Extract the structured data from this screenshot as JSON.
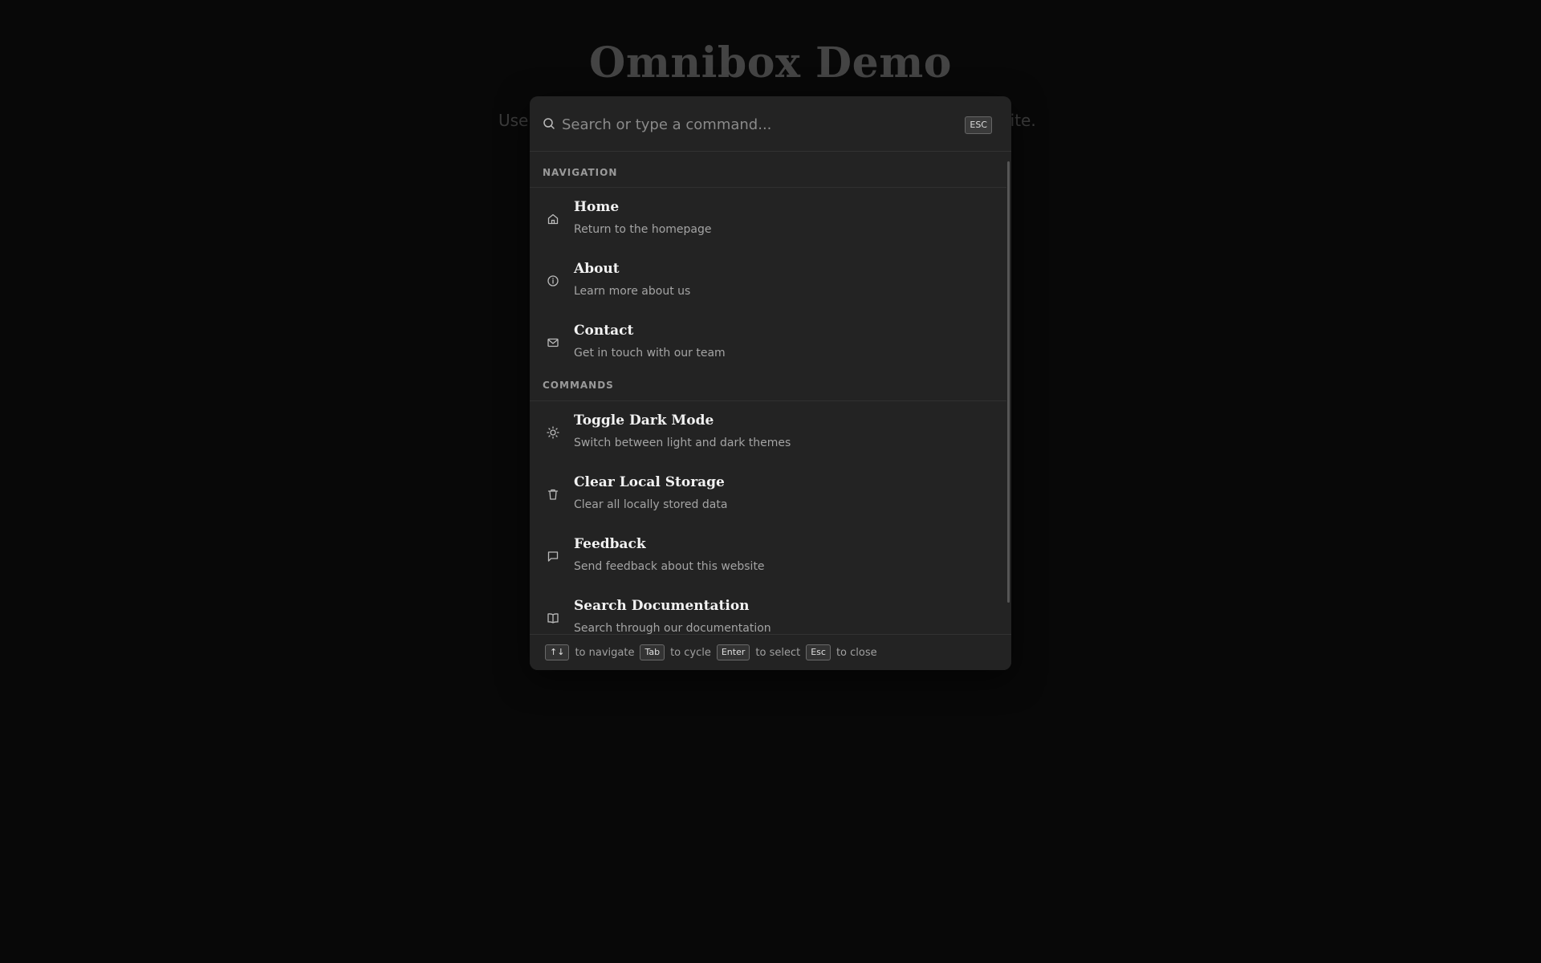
{
  "page": {
    "title": "Omnibox Demo",
    "subtitle_left": "Use",
    "subtitle_right": "osite."
  },
  "search": {
    "placeholder": "Search or type a command...",
    "esc_label": "ESC",
    "icon": "search-icon"
  },
  "sections": {
    "navigation": {
      "label": "NAVIGATION",
      "items": [
        {
          "title": "Home",
          "description": "Return to the homepage",
          "icon": "home-icon"
        },
        {
          "title": "About",
          "description": "Learn more about us",
          "icon": "info-icon"
        },
        {
          "title": "Contact",
          "description": "Get in touch with our team",
          "icon": "mail-icon"
        }
      ]
    },
    "commands": {
      "label": "COMMANDS",
      "items": [
        {
          "title": "Toggle Dark Mode",
          "description": "Switch between light and dark themes",
          "icon": "sun-icon"
        },
        {
          "title": "Clear Local Storage",
          "description": "Clear all locally stored data",
          "icon": "trash-icon"
        },
        {
          "title": "Feedback",
          "description": "Send feedback about this website",
          "icon": "message-icon"
        },
        {
          "title": "Search Documentation",
          "description": "Search through our documentation",
          "icon": "book-icon"
        }
      ]
    }
  },
  "footer": {
    "navigate_key": "↑↓",
    "navigate_text": "to navigate",
    "cycle_key": "Tab",
    "cycle_text": "to cycle",
    "select_key": "Enter",
    "select_text": "to select",
    "close_key": "Esc",
    "close_text": "to close"
  },
  "colors": {
    "background": "#080808",
    "panel": "#232323",
    "title_text": "#f2f2f2",
    "muted_text": "#a4a4a4"
  }
}
